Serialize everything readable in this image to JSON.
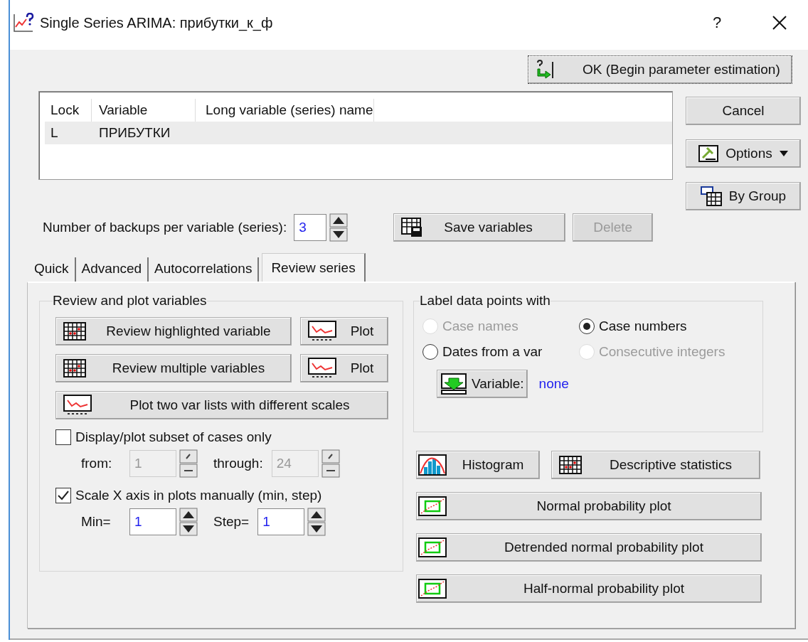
{
  "window": {
    "title": "Single Series ARIMA: прибутки_к_ф",
    "help": "?"
  },
  "ok_button": "OK (Begin parameter estimation)",
  "variables_table": {
    "columns": [
      "Lock",
      "Variable",
      "Long variable (series) name"
    ],
    "rows": [
      {
        "lock": "L",
        "variable": "ПРИБУТКИ",
        "selected": true
      }
    ]
  },
  "cancel_button": "Cancel",
  "options_button": "Options",
  "by_group_button": "By Group",
  "backups": {
    "label": "Number of backups per variable (series):",
    "value": "3"
  },
  "save_button": {
    "label": "Save variables",
    "disabled": false
  },
  "delete_button": {
    "label": "Delete",
    "disabled": true
  },
  "tabs": [
    {
      "label": "Quick",
      "selected": false
    },
    {
      "label": "Advanced",
      "selected": false
    },
    {
      "label": "Autocorrelations",
      "selected": false
    },
    {
      "label": "Review series",
      "selected": true
    }
  ],
  "review_group": {
    "title": "Review and plot variables",
    "rows": [
      {
        "label": "Review highlighted variable",
        "plot": "Plot"
      },
      {
        "label": "Review multiple variables",
        "plot": "Plot"
      }
    ],
    "plot_two": "Plot two var lists with different scales",
    "subset": {
      "label": "Display/plot subset of cases only",
      "checked": false,
      "from_label": "from:",
      "from": "1",
      "through_label": "through:",
      "through": "24"
    },
    "scale_x": {
      "label": "Scale X axis in plots manually (min, step)",
      "checked": true,
      "min_label": "Min=",
      "min": "1",
      "step_label": "Step=",
      "step": "1"
    }
  },
  "label_group": {
    "title": "Label data points with",
    "options": [
      {
        "label": "Case names",
        "selected": false,
        "disabled": true
      },
      {
        "label": "Case numbers",
        "selected": true,
        "disabled": false
      },
      {
        "label": "Dates from a var",
        "selected": false,
        "disabled": false
      },
      {
        "label": "Consecutive integers",
        "selected": false,
        "disabled": true
      }
    ],
    "variable_button": "Variable:",
    "variable_value": "none"
  },
  "histogram_button": "Histogram",
  "descriptive_button": "Descriptive statistics",
  "probability_buttons": [
    "Normal probability plot",
    "Detrended normal probability plot",
    "Half-normal probability plot"
  ]
}
